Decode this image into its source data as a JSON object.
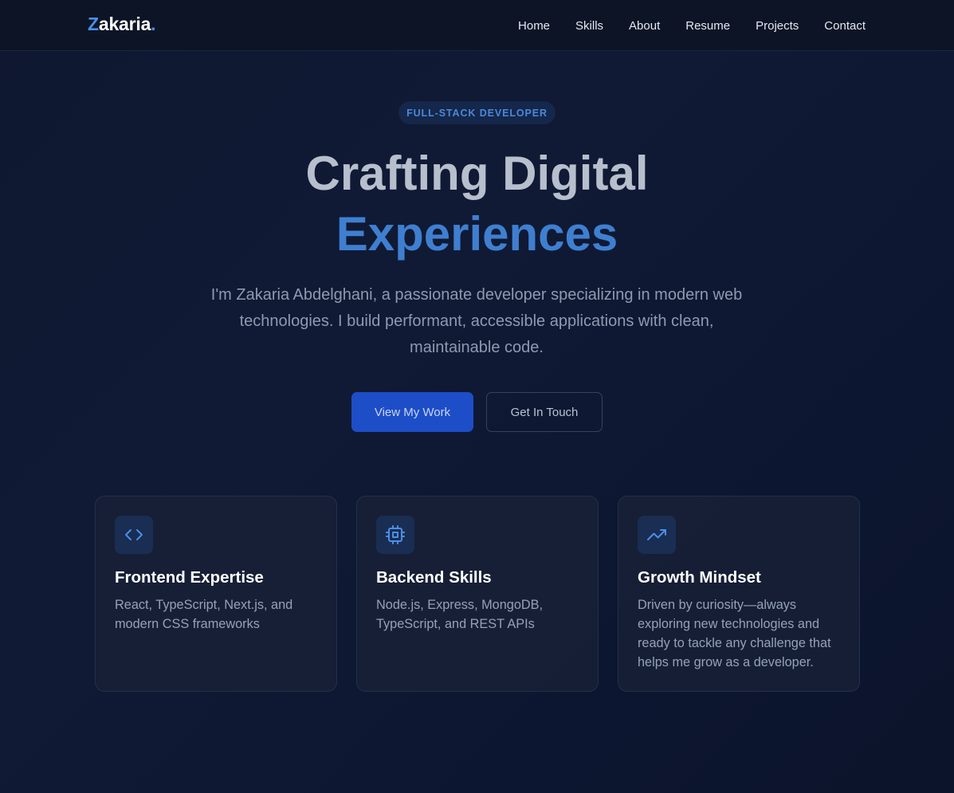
{
  "nav": {
    "logo_letter": "Z",
    "logo_rest": "akaria",
    "logo_dot": ".",
    "links": [
      "Home",
      "Skills",
      "About",
      "Resume",
      "Projects",
      "Contact"
    ]
  },
  "hero": {
    "badge": "FULL-STACK DEVELOPER",
    "title_line1": "Crafting Digital",
    "title_line2": "Experiences",
    "description": "I'm Zakaria Abdelghani, a passionate developer specializing in modern web technologies. I build performant, accessible applications with clean, maintainable code.",
    "primary_button": "View My Work",
    "secondary_button": "Get In Touch"
  },
  "cards": [
    {
      "icon": "code-icon",
      "title": "Frontend Expertise",
      "text": "React, TypeScript, Next.js, and modern CSS frameworks"
    },
    {
      "icon": "cpu-icon",
      "title": "Backend Skills",
      "text": "Node.js, Express, MongoDB, TypeScript, and REST APIs"
    },
    {
      "icon": "trending-up-icon",
      "title": "Growth Mindset",
      "text": "Driven by curiosity—always exploring new technologies and ready to tackle any challenge that helps me grow as a developer."
    }
  ],
  "colors": {
    "accent": "#4a8fe8",
    "primary_button": "#1d4ec8",
    "title_highlight": "#3f7fd0"
  }
}
